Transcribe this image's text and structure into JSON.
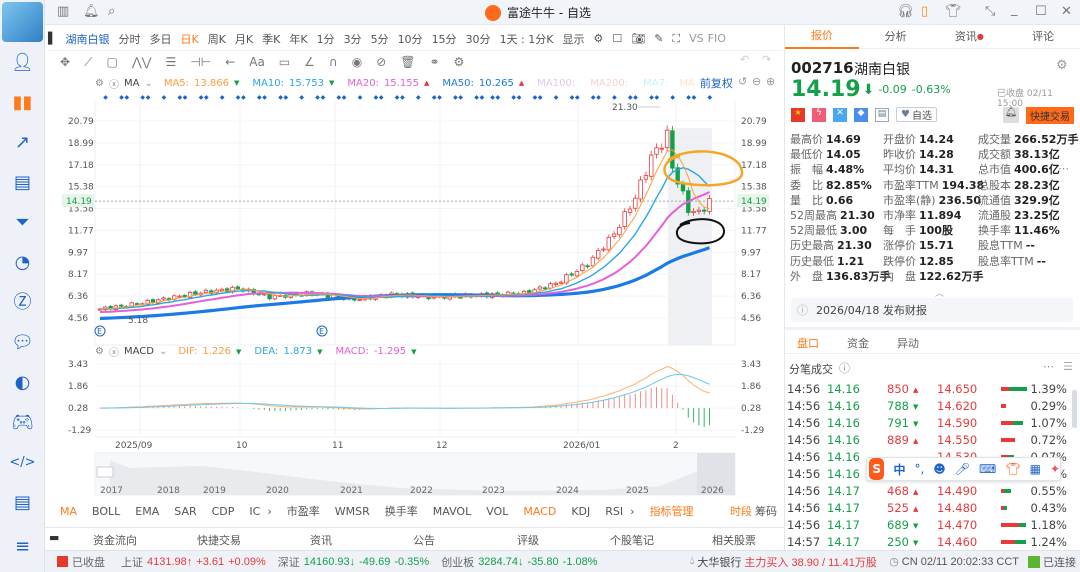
{
  "window": {
    "title": "富途牛牛 - 自选"
  },
  "toolbar": {
    "stock_tab": "湖南白银",
    "periods": [
      "分时",
      "多日",
      "日K",
      "周K",
      "月K",
      "季K",
      "年K",
      "1分",
      "3分",
      "5分",
      "10分",
      "15分",
      "30分",
      "1天 : 1分K",
      "显示"
    ],
    "active_period": "日K",
    "vs": "VS",
    "f10": "FIO"
  },
  "ma_legend": {
    "label": "MA",
    "ma5": "MA5:",
    "ma5_v": "13.866",
    "ma10": "MA10:",
    "ma10_v": "15.753",
    "ma20": "MA20:",
    "ma20_v": "15.155",
    "ma50": "MA50:",
    "ma50_v": "10.265",
    "ma100": "MA100:",
    "ma200": "MA200:",
    "ma7": "MA7:",
    "ma_extra": "MA",
    "adjust": "前复权"
  },
  "macd_legend": {
    "label": "MACD",
    "dif": "DIF:",
    "dif_v": "1.226",
    "dea": "DEA:",
    "dea_v": "1.873",
    "macd": "MACD:",
    "macd_v": "-1.295"
  },
  "colors": {
    "ma5": "#ff9d3c",
    "ma10": "#28a8e8",
    "ma20": "#e55fd8",
    "ma50": "#1a7be6",
    "up": "#e8393b",
    "down": "#14a04a",
    "accent": "#ff7a1a"
  },
  "chart_data": {
    "type": "candlestick",
    "price_ticks": [
      "20.79",
      "18.99",
      "17.18",
      "15.38",
      "13.58",
      "11.77",
      "9.97",
      "8.17",
      "6.36",
      "4.56"
    ],
    "last_price_tag": "14.19",
    "high_label": "21.30",
    "low_label": "5.18",
    "date_labels": [
      "2025/09",
      "10",
      "11",
      "12",
      "2026/01",
      "2"
    ],
    "close_keypoints": [
      [
        0,
        5.3
      ],
      [
        8,
        5.8
      ],
      [
        18,
        6.6
      ],
      [
        26,
        7.0
      ],
      [
        32,
        6.3
      ],
      [
        40,
        6.6
      ],
      [
        48,
        6.1
      ],
      [
        55,
        6.5
      ],
      [
        62,
        6.3
      ],
      [
        70,
        6.4
      ],
      [
        80,
        6.6
      ],
      [
        86,
        7.4
      ],
      [
        92,
        9.0
      ],
      [
        97,
        11.5
      ],
      [
        101,
        14.5
      ],
      [
        104,
        17.8
      ],
      [
        107,
        19.6
      ],
      [
        108,
        17.0
      ],
      [
        111,
        13.5
      ],
      [
        113,
        13.2
      ],
      [
        115,
        14.2
      ]
    ],
    "macd_ticks": [
      "3.43",
      "1.86",
      "0.28",
      "-1.29"
    ],
    "overview_years": [
      "2017",
      "2018",
      "2019",
      "2020",
      "2021",
      "2022",
      "2023",
      "2024",
      "2025",
      "2026"
    ]
  },
  "indicators": {
    "main": [
      "MA",
      "BOLL",
      "EMA",
      "SAR",
      "CDP",
      "IC"
    ],
    "sub": [
      "市盈率",
      "WMSR",
      "换手率",
      "MAVOL",
      "VOL",
      "MACD",
      "KDJ",
      "RSI"
    ],
    "manage": "指标管理",
    "right1": "时段",
    "right2": "筹码"
  },
  "bottom_tabs": [
    "资金流向",
    "快捷交易",
    "资讯",
    "公告",
    "评级",
    "个股笔记",
    "相关股票"
  ],
  "quote": {
    "tabs": [
      "报价",
      "分析",
      "资讯",
      "评论"
    ],
    "code": "002716",
    "name": "湖南白银",
    "price": "14.19",
    "arrow": "⬇",
    "change": "-0.09",
    "pct": "-0.63%",
    "status": "已收盘 02/11 15:00",
    "watch": "自选",
    "trade": "快捷交易",
    "stats": [
      [
        "最高价",
        "14.69",
        "r"
      ],
      [
        "开盘价",
        "14.24",
        "g"
      ],
      [
        "成交量",
        "266.52万手",
        ""
      ],
      [
        "最低价",
        "14.05",
        "g"
      ],
      [
        "昨收价",
        "14.28",
        ""
      ],
      [
        "成交额",
        "38.13亿",
        ""
      ],
      [
        "振　幅",
        "4.48%",
        ""
      ],
      [
        "平均价",
        "14.31",
        "r"
      ],
      [
        "总市值",
        "400.6亿",
        ""
      ],
      [
        "委　比",
        "82.85%",
        ""
      ],
      [
        "市盈率TTM",
        "194.38",
        ""
      ],
      [
        "总股本",
        "28.23亿",
        ""
      ],
      [
        "量　比",
        "0.66",
        ""
      ],
      [
        "市盈率(静)",
        "236.50",
        ""
      ],
      [
        "流通值",
        "329.9亿",
        ""
      ],
      [
        "52周最高",
        "21.30",
        "r"
      ],
      [
        "市净率",
        "11.894",
        ""
      ],
      [
        "流通股",
        "23.25亿",
        ""
      ],
      [
        "52周最低",
        "3.00",
        "g"
      ],
      [
        "每　手",
        "100股",
        ""
      ],
      [
        "换手率",
        "11.46%",
        ""
      ],
      [
        "历史最高",
        "21.30",
        "r"
      ],
      [
        "涨停价",
        "15.71",
        "r"
      ],
      [
        "股息TTM",
        "--",
        ""
      ],
      [
        "历史最低",
        "1.21",
        "g"
      ],
      [
        "跌停价",
        "12.85",
        "g"
      ],
      [
        "股息率TTM",
        "--",
        ""
      ],
      [
        "外　盘",
        "136.83万手",
        "r"
      ],
      [
        "内　盘",
        "122.62万手",
        "g"
      ]
    ],
    "notice": "2026/04/18  发布财报",
    "sub_tabs": [
      "盘口",
      "资金",
      "异动"
    ],
    "ts_title": "分笔成交",
    "ticks": [
      {
        "t": "14:56",
        "p": "14.16",
        "v": "850",
        "d": "up",
        "p2": "14.650",
        "pct": "1.39%",
        "bar": [
          0.3,
          0.7
        ]
      },
      {
        "t": "14:56",
        "p": "14.16",
        "v": "788",
        "d": "down",
        "p2": "14.620",
        "pct": "0.29%",
        "bar": [
          0.2,
          0
        ]
      },
      {
        "t": "14:56",
        "p": "14.16",
        "v": "791",
        "d": "down",
        "p2": "14.590",
        "pct": "1.07%",
        "bar": [
          0.45,
          0.4
        ]
      },
      {
        "t": "14:56",
        "p": "14.16",
        "v": "889",
        "d": "up",
        "p2": "14.550",
        "pct": "0.72%",
        "bar": [
          0.55,
          0
        ]
      },
      {
        "t": "14:56",
        "p": "14.16",
        "v": "",
        "d": "",
        "p2": "14.530",
        "pct": "0.07%",
        "bar": [
          0.3,
          0.2
        ]
      },
      {
        "t": "14:56",
        "p": "14.16",
        "v": "",
        "d": "",
        "p2": "",
        "pct": "%",
        "bar": [
          0,
          0
        ]
      },
      {
        "t": "14:56",
        "p": "14.17",
        "v": "468",
        "d": "up",
        "p2": "14.490",
        "pct": "0.55%",
        "bar": [
          0.1,
          0.3
        ]
      },
      {
        "t": "14:56",
        "p": "14.17",
        "v": "525",
        "d": "up",
        "p2": "14.480",
        "pct": "0.43%",
        "bar": [
          0.1,
          0.15
        ]
      },
      {
        "t": "14:56",
        "p": "14.17",
        "v": "689",
        "d": "down",
        "p2": "14.470",
        "pct": "1.18%",
        "bar": [
          0.7,
          0.25
        ]
      },
      {
        "t": "14:57",
        "p": "14.17",
        "v": "250",
        "d": "down",
        "p2": "14.460",
        "pct": "1.24%",
        "bar": [
          0.55,
          0.4
        ]
      }
    ]
  },
  "ime": {
    "lang": "中",
    "punct": "°,"
  },
  "statusbar": {
    "market": "已收盘",
    "sh": "上证",
    "sh_v": "4131.98↑",
    "sh_c": "+3.61",
    "sh_p": "+0.09%",
    "sz": "深证",
    "sz_v": "14160.93↓",
    "sz_c": "-49.69",
    "sz_p": "-0.35%",
    "cy": "创业板",
    "cy_v": "3284.74↓",
    "cy_c": "-35.80",
    "cy_p": "-1.08%",
    "news_stock": "大华银行",
    "news": "主力买入 38.90 / 11.41万股",
    "time": "CN 02/11 20:02:33 CCT",
    "conn": "已连接"
  }
}
